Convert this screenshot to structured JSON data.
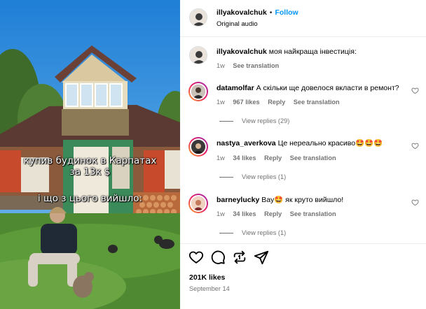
{
  "post": {
    "author": "illyakovalchuk",
    "follow_label": "Follow",
    "dot": "•",
    "audio": "Original audio",
    "likes": "201K likes",
    "date": "September 14"
  },
  "overlay_caption": {
    "line1": "купив будинок в Карпатах",
    "line2": "за 13к $",
    "line3": "і що з цього вийшло:"
  },
  "comments": [
    {
      "user": "illyakovalchuk",
      "text": "моя найкраща інвестиція:",
      "time": "1w",
      "likes": "",
      "reply": "",
      "translate": "See translation",
      "view_replies": ""
    },
    {
      "user": "datamolfar",
      "text": "А скільки ще довелося вкласти в ремонт?",
      "time": "1w",
      "likes": "967 likes",
      "reply": "Reply",
      "translate": "See translation",
      "view_replies": "View replies (29)"
    },
    {
      "user": "nastya_averkova",
      "text": "Це нереально красиво🤩🤩🤩",
      "time": "1w",
      "likes": "34 likes",
      "reply": "Reply",
      "translate": "See translation",
      "view_replies": "View replies (1)"
    },
    {
      "user": "barneylucky",
      "text": "Вау🤩 як круто вийшло!",
      "time": "1w",
      "likes": "34 likes",
      "reply": "Reply",
      "translate": "See translation",
      "view_replies": "View replies (1)"
    }
  ],
  "icons": {
    "like": "heart-icon",
    "comment": "comment-icon",
    "share": "repost-icon",
    "send": "send-icon",
    "comment_like": "small-heart-icon"
  },
  "colors": {
    "link_blue": "#0095f6",
    "secondary_text": "#737373",
    "story_ring": "#e91e63"
  }
}
